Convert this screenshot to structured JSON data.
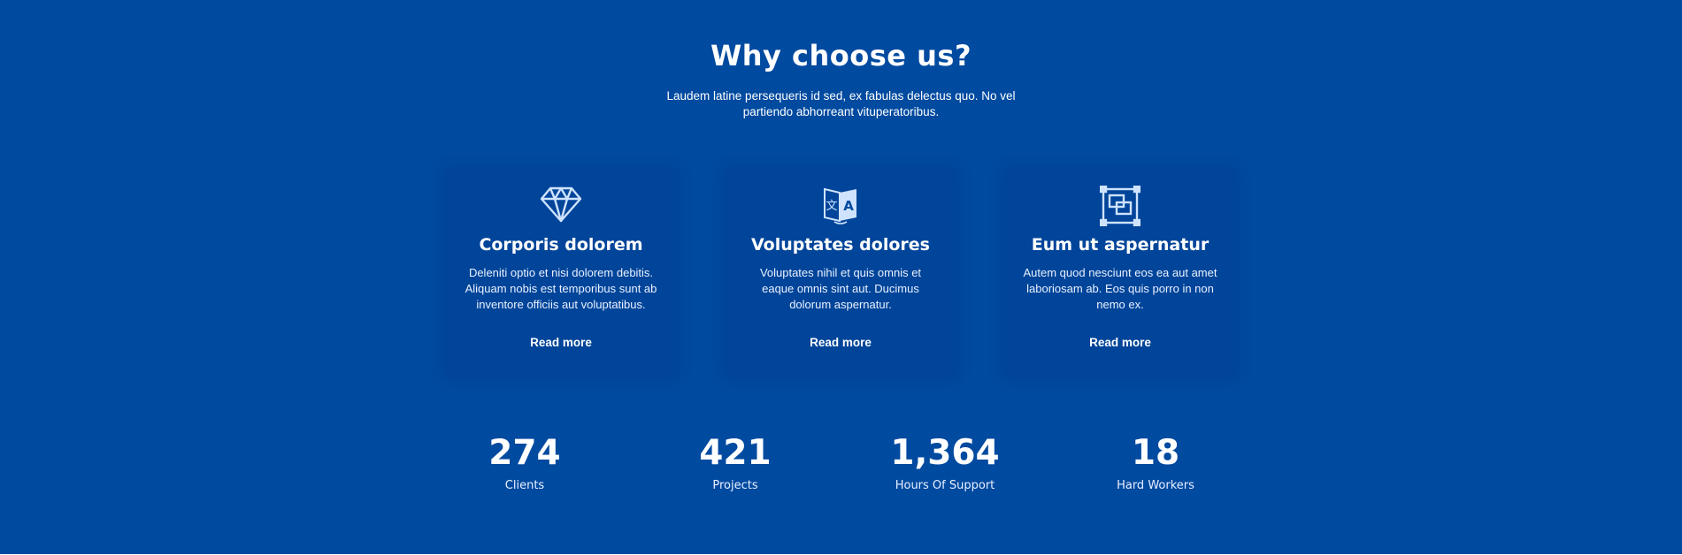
{
  "header": {
    "title": "Why choose us?",
    "subtitle": "Laudem latine persequeris id sed, ex fabulas delectus quo. No vel partiendo abhorreant vituperatoribus."
  },
  "cards": [
    {
      "icon": "diamond-icon",
      "title": "Corporis dolorem",
      "text": "Deleniti optio et nisi dolorem debitis. Aliquam nobis est temporibus sunt ab inventore officiis aut voluptatibus.",
      "link": "Read more"
    },
    {
      "icon": "translate-icon",
      "title": "Voluptates dolores",
      "text": "Voluptates nihil et quis omnis et eaque omnis sint aut. Ducimus dolorum aspernatur.",
      "link": "Read more"
    },
    {
      "icon": "layers-frame-icon",
      "title": "Eum ut aspernatur",
      "text": "Autem quod nesciunt eos ea aut amet laboriosam ab. Eos quis porro in non nemo ex.",
      "link": "Read more"
    }
  ],
  "stats": [
    {
      "value": "274",
      "label": "Clients"
    },
    {
      "value": "421",
      "label": "Projects"
    },
    {
      "value": "1,364",
      "label": "Hours Of Support"
    },
    {
      "value": "18",
      "label": "Hard Workers"
    }
  ],
  "colors": {
    "background": "#004aa0",
    "card": "#01459a",
    "icon": "#cfe3ff"
  }
}
